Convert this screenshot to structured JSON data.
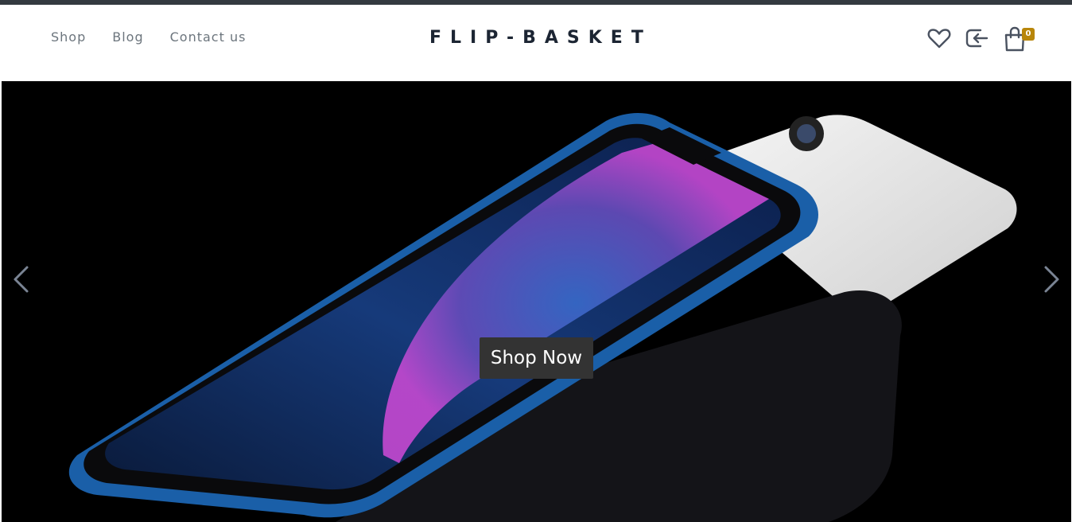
{
  "nav": {
    "links": [
      {
        "label": "Shop"
      },
      {
        "label": "Blog"
      },
      {
        "label": "Contact us"
      }
    ],
    "brand": "FLIP-BASKET"
  },
  "actions": {
    "wishlist_icon": "heart-icon",
    "login_icon": "login-icon",
    "cart_icon": "shopping-bag-icon",
    "cart_count": "0"
  },
  "hero": {
    "cta_label": "Shop Now",
    "prev_icon": "chevron-left-icon",
    "next_icon": "chevron-right-icon"
  },
  "colors": {
    "top_strip": "#343a40",
    "brand_text": "#1c2533",
    "nav_text": "#6c757d",
    "badge": "#b8860b",
    "hero_bg": "#000000",
    "cta_bg": "#333333"
  }
}
